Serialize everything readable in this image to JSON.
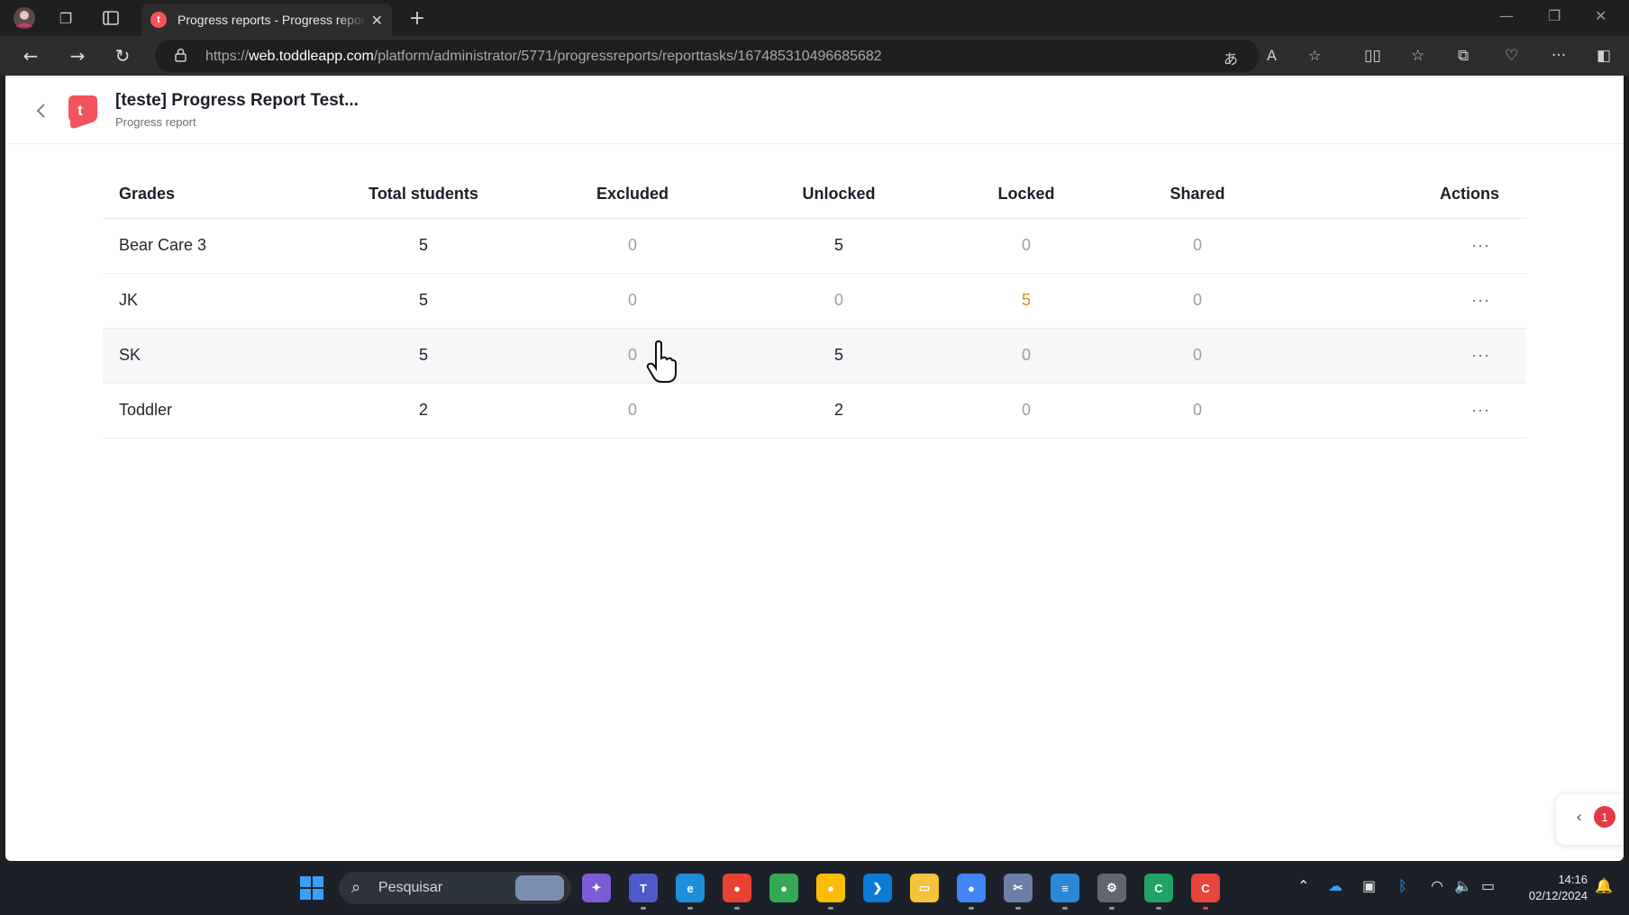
{
  "browser": {
    "tab_title": "Progress reports - Progress repor",
    "tab_favicon_letter": "t",
    "url_prefix": "https://",
    "url_domain": "web.toddleapp.com",
    "url_path": "/platform/administrator/5771/progressreports/reporttasks/167485310496685682"
  },
  "header": {
    "logo_letter": "t",
    "title": "[teste] Progress Report Test...",
    "subtitle": "Progress report"
  },
  "table": {
    "columns": [
      "Grades",
      "Total students",
      "Excluded",
      "Unlocked",
      "Locked",
      "Shared",
      "Actions"
    ],
    "rows": [
      {
        "grade": "Bear Care 3",
        "total": "5",
        "excluded": "0",
        "unlocked": "5",
        "locked": "0",
        "shared": "0",
        "actions": "···"
      },
      {
        "grade": "JK",
        "total": "5",
        "excluded": "0",
        "unlocked": "0",
        "locked": "5",
        "shared": "0",
        "actions": "···"
      },
      {
        "grade": "SK",
        "total": "5",
        "excluded": "0",
        "unlocked": "5",
        "locked": "0",
        "shared": "0",
        "actions": "···"
      },
      {
        "grade": "Toddler",
        "total": "2",
        "excluded": "0",
        "unlocked": "2",
        "locked": "0",
        "shared": "0",
        "actions": "···"
      }
    ]
  },
  "side_panel": {
    "badge": "1"
  },
  "taskbar": {
    "search_placeholder": "Pesquisar",
    "time": "14:16",
    "date": "02/12/2024"
  },
  "colors": {
    "brand": "#f2545b",
    "locked_highlight": "#d4911f",
    "badge": "#e23a44"
  }
}
